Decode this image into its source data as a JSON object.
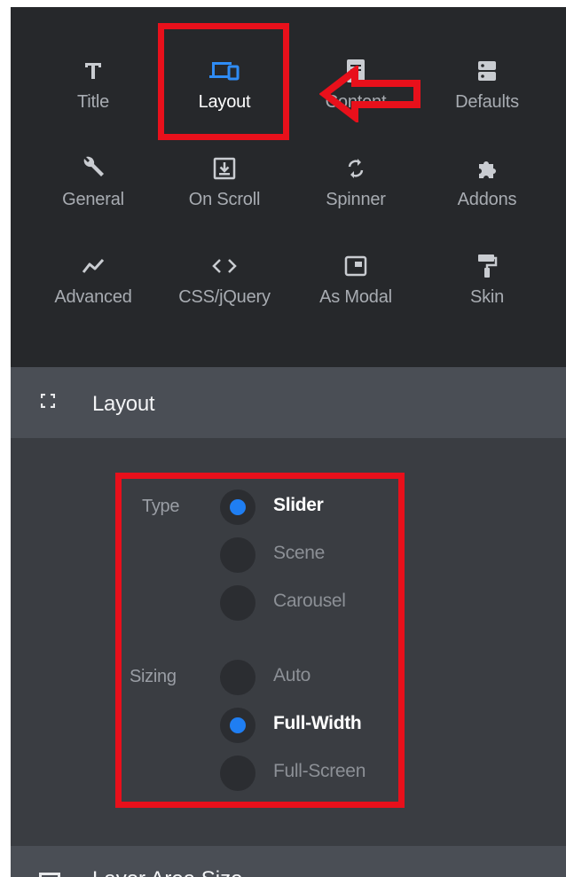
{
  "toolbar": {
    "items": [
      {
        "label": "Title",
        "icon": "text-t-icon",
        "active": false
      },
      {
        "label": "Layout",
        "icon": "devices-icon",
        "active": true
      },
      {
        "label": "Content",
        "icon": "document-icon",
        "active": false
      },
      {
        "label": "Defaults",
        "icon": "server-icon",
        "active": false
      },
      {
        "label": "General",
        "icon": "wrench-icon",
        "active": false
      },
      {
        "label": "On Scroll",
        "icon": "download-box-icon",
        "active": false
      },
      {
        "label": "Spinner",
        "icon": "refresh-icon",
        "active": false
      },
      {
        "label": "Addons",
        "icon": "puzzle-icon",
        "active": false
      },
      {
        "label": "Advanced",
        "icon": "line-chart-icon",
        "active": false
      },
      {
        "label": "CSS/jQuery",
        "icon": "code-brackets-icon",
        "active": false
      },
      {
        "label": "As Modal",
        "icon": "modal-window-icon",
        "active": false
      },
      {
        "label": "Skin",
        "icon": "paint-roller-icon",
        "active": false
      }
    ]
  },
  "section": {
    "title": "Layout",
    "icon": "expand-corners-icon"
  },
  "form": {
    "type": {
      "label": "Type",
      "selected": "Slider",
      "options": [
        "Slider",
        "Scene",
        "Carousel"
      ]
    },
    "sizing": {
      "label": "Sizing",
      "selected": "Full-Width",
      "options": [
        "Auto",
        "Full-Width",
        "Full-Screen"
      ]
    }
  },
  "next_section": {
    "title": "Layer Area Size",
    "icon": "layer-area-icon"
  },
  "colors": {
    "panel_bg": "#3a3d42",
    "toolbar_bg": "#26282b",
    "header_bg": "#4a4e55",
    "radio_selected": "#1f7ef2",
    "highlight": "#e8101b"
  }
}
